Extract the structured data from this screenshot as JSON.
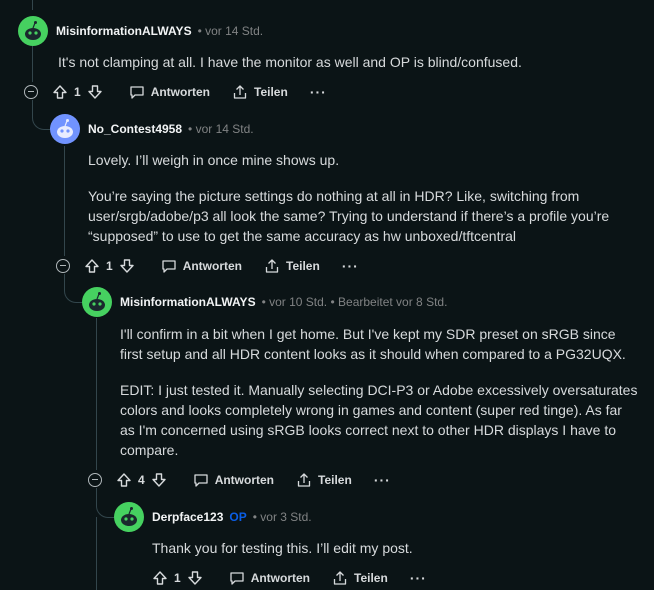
{
  "actions": {
    "reply": "Antworten",
    "share": "Teilen",
    "more": "···"
  },
  "comments": [
    {
      "author": "MisinformationALWAYS",
      "meta": "• vor 14 Std.",
      "paragraphs": [
        "It's not clamping at all. I have the monitor as well and OP is blind/confused."
      ],
      "votes": "1",
      "avatar_color": "#46d160"
    },
    {
      "author": "No_Contest4958",
      "meta": "• vor 14 Std.",
      "paragraphs": [
        "Lovely. I’ll weigh in once mine shows up.",
        "You’re saying the picture settings do nothing at all in HDR? Like, switching from user/srgb/adobe/p3 all look the same? Trying to understand if there’s a profile you’re “supposed” to use to get the same accuracy as hw unboxed/tftcentral"
      ],
      "votes": "1",
      "avatar_color": "#7193ff"
    },
    {
      "author": "MisinformationALWAYS",
      "meta": "• vor 10 Std. • Bearbeitet vor 8 Std.",
      "paragraphs": [
        "I'll confirm in a bit when I get home. But I've kept my SDR preset on sRGB since first setup and all HDR content looks as it should when compared to a PG32UQX.",
        "EDIT: I just tested it. Manually selecting DCI-P3 or Adobe excessively oversaturates colors and looks completely wrong in games and content (super red tinge). As far as I'm concerned using sRGB looks correct next to other HDR displays I have to compare."
      ],
      "votes": "4",
      "avatar_color": "#46d160"
    },
    {
      "author": "Derpface123",
      "op_badge": "OP",
      "meta": "• vor 3 Std.",
      "paragraphs": [
        "Thank you for testing this. I’ll edit my post."
      ],
      "votes": "1",
      "avatar_color": "#46d160"
    }
  ]
}
